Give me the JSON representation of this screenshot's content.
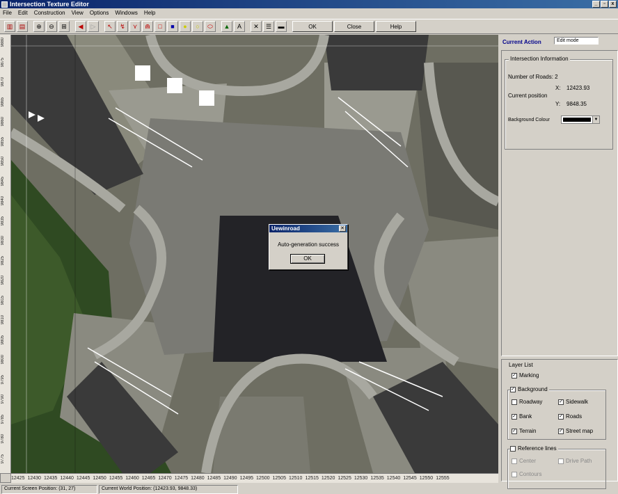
{
  "window": {
    "title": "Intersection Texture Editor",
    "controls": [
      "_",
      "▫",
      "x"
    ]
  },
  "menu": [
    "File",
    "Edit",
    "Construction",
    "View",
    "Options",
    "Windows",
    "Help"
  ],
  "toolbar": {
    "ok_label": "OK",
    "close_label": "Close",
    "help_label": "Help"
  },
  "ruler": {
    "x_labels": [
      "12425",
      "12430",
      "12435",
      "12440",
      "12445",
      "12450",
      "12455",
      "12460",
      "12465",
      "12470",
      "12475",
      "12480",
      "12485",
      "12490",
      "12495",
      "12500",
      "12505",
      "12510",
      "12515",
      "12520",
      "12525",
      "12530",
      "12535",
      "12540",
      "12545",
      "12550",
      "12555"
    ],
    "y_labels": [
      "9880",
      "9875",
      "9870",
      "9865",
      "9860",
      "9855",
      "9850",
      "9845",
      "9840",
      "9835",
      "9830",
      "9825",
      "9820",
      "9815",
      "9810",
      "9805",
      "9800",
      "9795",
      "9790",
      "9785",
      "9780",
      "9775"
    ]
  },
  "side": {
    "current_action_label": "Current Action",
    "current_action_value": "Edit mode",
    "intersection": {
      "title": "Intersection Information",
      "roads_label": "Number of Roads: 2",
      "position_label": "Current position",
      "x_label": "X:",
      "x_value": "12423.93",
      "y_label": "Y:",
      "y_value": "9848.35",
      "bg_label": "Background Colour"
    },
    "layers": {
      "title": "Layer List",
      "marking": "Marking",
      "background": "Background",
      "roadway": "Roadway",
      "sidewalk": "Sidewalk",
      "bank": "Bank",
      "roads": "Roads",
      "terrain": "Terrain",
      "streetmap": "Street map",
      "reference": "Reference lines",
      "center": "Center",
      "drivepath": "Drive Path",
      "contours": "Contours"
    }
  },
  "dialog": {
    "title": "Uewinroad",
    "message": "Auto-generation success",
    "ok": "OK"
  },
  "status": {
    "screen": "Current Screen Position: (31, 27)",
    "world": "Current World Position: (12423.93, 9848.33)"
  },
  "colors": {
    "titlebar": "#0a246a",
    "road": "#3c3c3c",
    "sidewalk": "#a8a8a0",
    "vegetation": "#3d5a2a"
  }
}
